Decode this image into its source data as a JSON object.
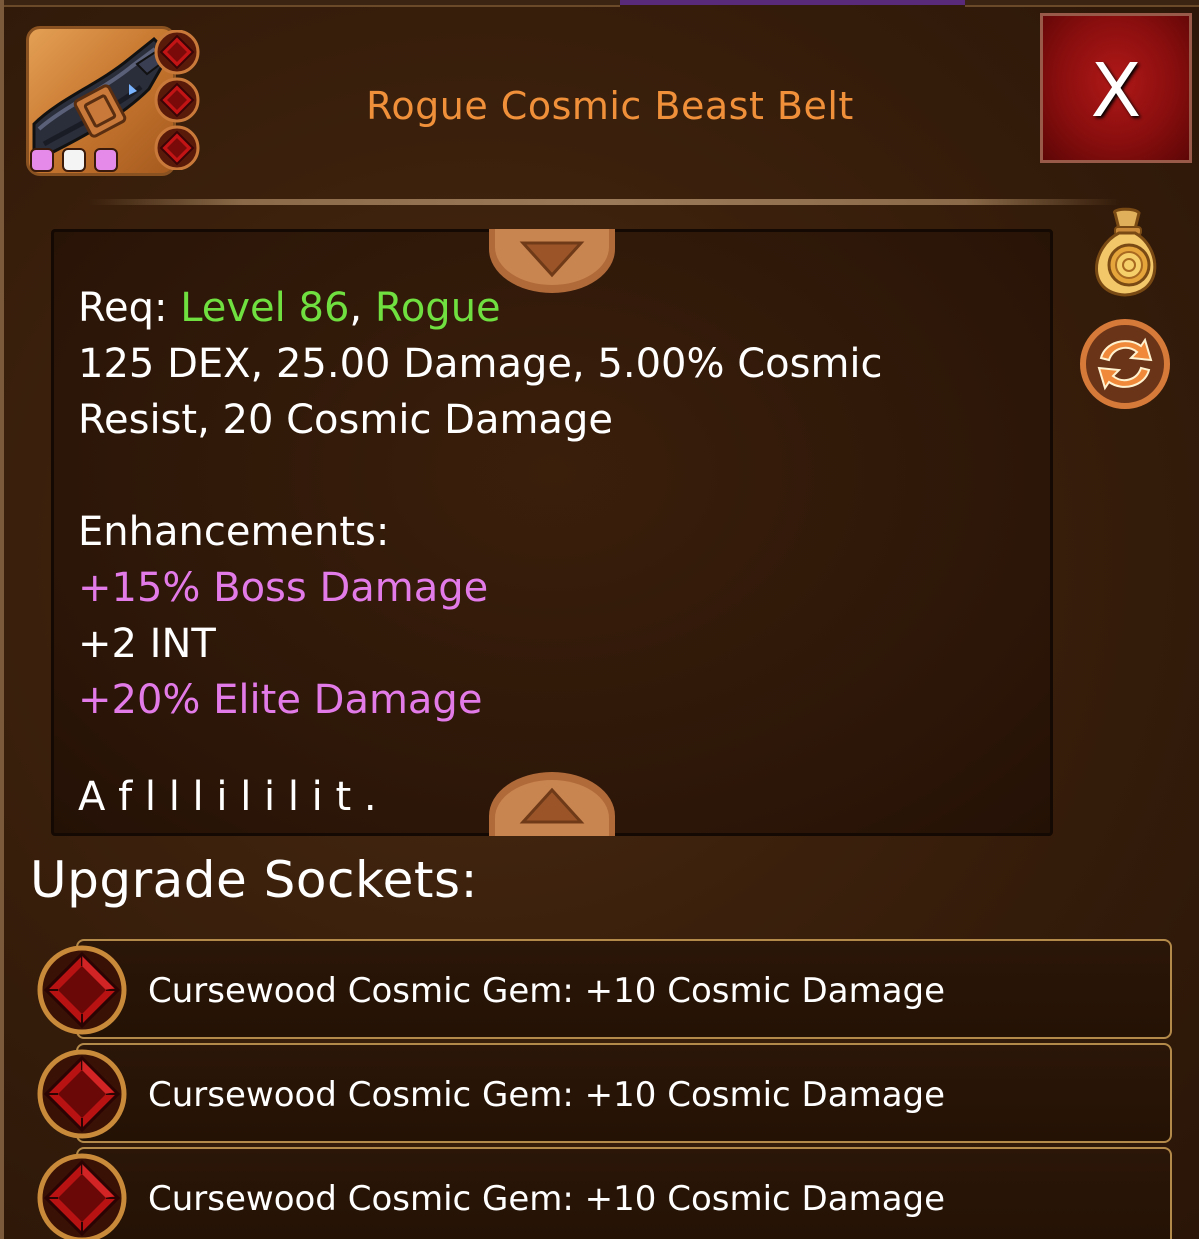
{
  "item": {
    "title": "Rogue Cosmic Beast Belt",
    "quality_dots": [
      "pink",
      "white",
      "pink"
    ],
    "icon": "belt-icon"
  },
  "close_button": {
    "label": "X"
  },
  "description": {
    "req_label": "Req: ",
    "req_level": "Level 86",
    "req_sep": ", ",
    "req_class": "Rogue",
    "stats_line1": "125 DEX, 25.00 Damage, 5.00% Cosmic",
    "stats_line2": "Resist, 20 Cosmic Damage",
    "enhancements_heading": "Enhancements:",
    "enhancements": [
      {
        "text": "+15% Boss Damage",
        "color": "pink"
      },
      {
        "text": "+2 INT",
        "color": "white"
      },
      {
        "text": "+20% Elite Damage",
        "color": "pink"
      }
    ],
    "flavor_cut": "A          f  l  l    l    i                    l  i l i t    ."
  },
  "sockets": {
    "heading": "Upgrade Sockets:",
    "items": [
      {
        "label": "Cursewood Cosmic Gem: +10 Cosmic Damage",
        "icon": "red-gem-icon"
      },
      {
        "label": "Cursewood Cosmic Gem: +10 Cosmic Damage",
        "icon": "red-gem-icon"
      },
      {
        "label": "Cursewood Cosmic Gem: +10 Cosmic Damage",
        "icon": "red-gem-icon"
      }
    ]
  },
  "side_buttons": {
    "sell": "gold-bag-icon",
    "swap": "swap-arrows-icon"
  },
  "colors": {
    "title": "#f0903a",
    "green": "#6fe040",
    "pink": "#e27ae8",
    "close_bg": "#8a0e0e"
  }
}
